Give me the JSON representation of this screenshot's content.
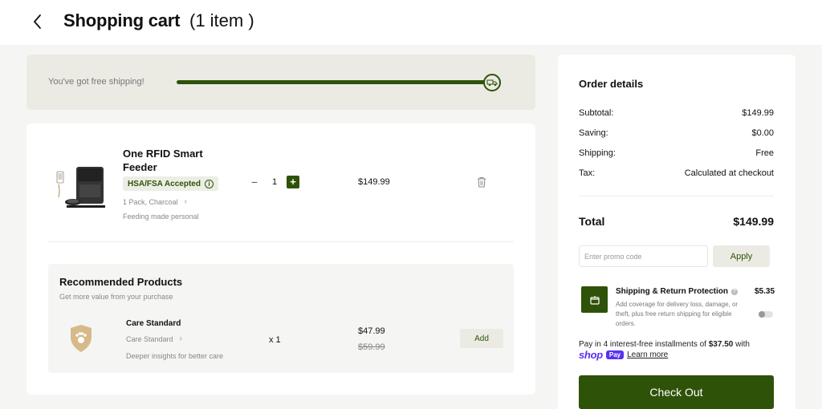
{
  "header": {
    "title": "Shopping cart",
    "count": "(1 item )"
  },
  "shipping": {
    "message": "You've got free shipping!",
    "progress": 1.0
  },
  "cart_item": {
    "name": "One RFID Smart Feeder",
    "badge": "HSA/FSA Accepted",
    "variant": "1 Pack, Charcoal",
    "tagline": "Feeding made personal",
    "quantity": "1",
    "price": "$149.99"
  },
  "recommended": {
    "title": "Recommended Products",
    "subtitle": "Get more value from your purchase",
    "item": {
      "name": "Care Standard",
      "variant": "Care Standard",
      "tagline": "Deeper insights for better care",
      "quantity": "x 1",
      "price": "$47.99",
      "original_price": "$59.99",
      "add_label": "Add"
    }
  },
  "order": {
    "title": "Order details",
    "rows": [
      {
        "label": "Subtotal:",
        "value": "$149.99"
      },
      {
        "label": "Saving:",
        "value": "$0.00"
      },
      {
        "label": "Shipping:",
        "value": "Free"
      },
      {
        "label": "Tax:",
        "value": "Calculated at checkout"
      }
    ],
    "total_label": "Total",
    "total_value": "$149.99",
    "promo_placeholder": "Enter promo code",
    "apply_label": "Apply",
    "protection": {
      "title": "Shipping & Return Protection",
      "price": "$5.35",
      "description": "Add coverage for delivery loss, damage, or theft, plus free return shipping for eligible orders.",
      "enabled": false
    },
    "pay_prefix": "Pay in 4 interest-free installments of ",
    "pay_amount": "$37.50",
    "pay_suffix": " with",
    "shop_word": "shop",
    "pay_badge": "Pay",
    "learn_more": "Learn more",
    "checkout_label": "Check Out"
  },
  "colors": {
    "brand_green": "#2f5209",
    "shop_pay": "#5a31f4"
  }
}
